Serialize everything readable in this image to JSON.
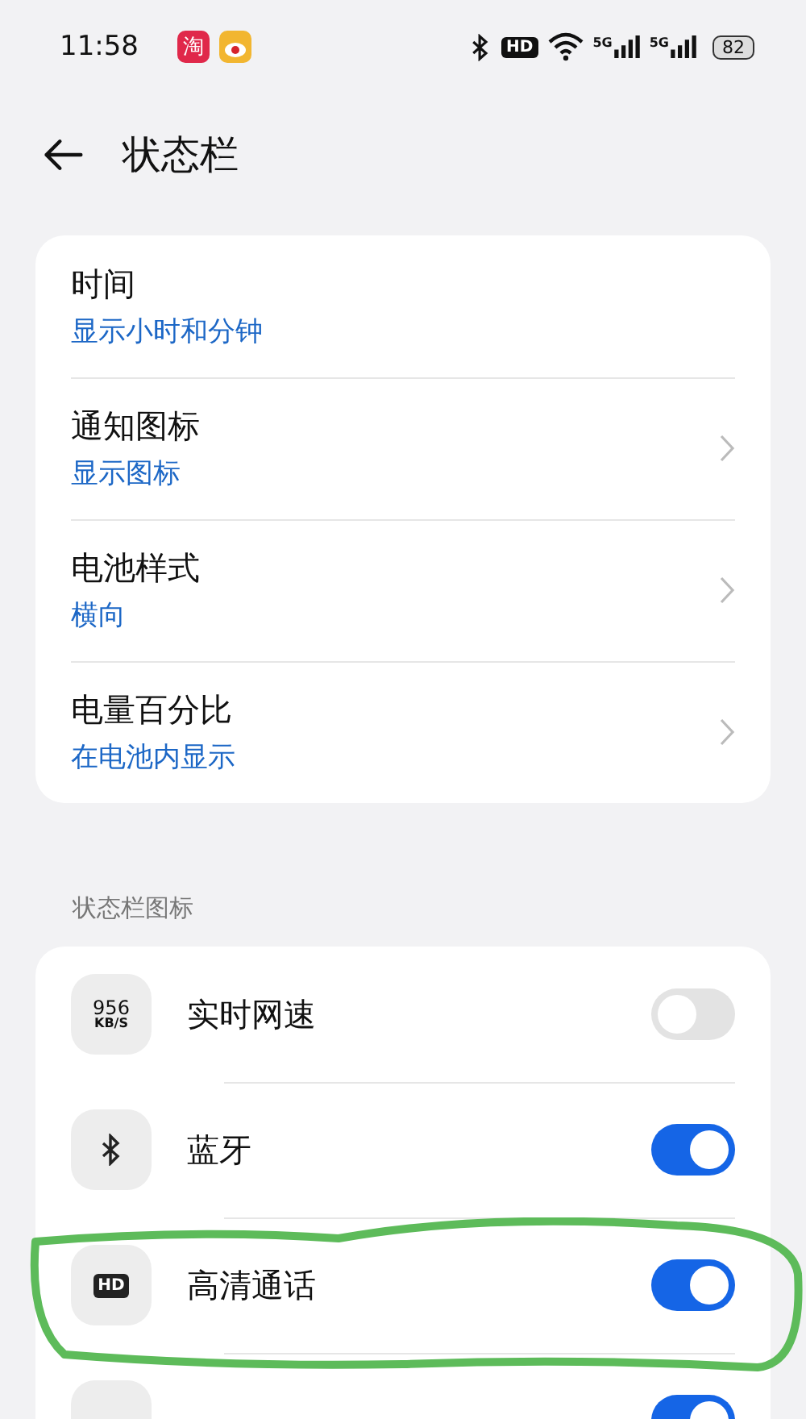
{
  "status_bar": {
    "time": "11:58",
    "app_icons": [
      {
        "kind": "text",
        "glyph": "淘",
        "color": "#e0284a"
      },
      {
        "kind": "eye",
        "color": "#f2b630"
      }
    ],
    "network_labels": [
      "5G",
      "5G"
    ],
    "hd_label": "HD",
    "battery": "82"
  },
  "header": {
    "title": "状态栏"
  },
  "settings": [
    {
      "title": "时间",
      "value": "显示小时和分钟",
      "chevron": false
    },
    {
      "title": "通知图标",
      "value": "显示图标",
      "chevron": true
    },
    {
      "title": "电池样式",
      "value": "横向",
      "chevron": true
    },
    {
      "title": "电量百分比",
      "value": "在电池内显示",
      "chevron": true
    }
  ],
  "section_title": "状态栏图标",
  "icon_toggles": [
    {
      "kind": "speed",
      "icon_text": [
        "956",
        "KB/S"
      ],
      "label": "实时网速",
      "on": false
    },
    {
      "kind": "bluetooth",
      "label": "蓝牙",
      "on": true
    },
    {
      "kind": "hd",
      "icon_text": [
        "HD"
      ],
      "label": "高清通话",
      "on": true
    },
    {
      "kind": "partial",
      "on": true
    }
  ]
}
